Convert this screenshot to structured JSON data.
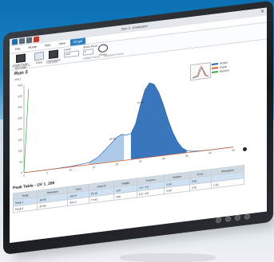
{
  "window": {
    "title": "Run 3 - Evaluation"
  },
  "menu": {
    "items": [
      "File",
      "Home",
      "Run",
      "View",
      "Graph"
    ],
    "active_index": 4
  },
  "ribbon": {
    "buttons": [
      {
        "label": "Single Peak / All Peaks",
        "icon": "peak-select-icon"
      },
      {
        "label": "Copy",
        "icon": "copy-icon"
      },
      {
        "label": "Calculation",
        "icon": "calculator-icon"
      },
      {
        "label": "Reset",
        "icon": "reset-icon"
      }
    ],
    "level_label": "Level",
    "level_value": "50.0",
    "show_point_label": "Show Point",
    "show_point_value": "5",
    "group_labels": [
      "Graph Options",
      "Calculate",
      "Global Points",
      "Standard Points"
    ]
  },
  "chart_header": {
    "title": "Run 3",
    "y_unit": "mAU"
  },
  "chart_data": {
    "type": "area",
    "title": "Run 3",
    "ylabel": "mAU",
    "xlim": [
      0,
      45
    ],
    "ylim": [
      0,
      400
    ],
    "y_ticks": [
      400,
      350,
      300,
      250,
      200,
      150,
      100,
      50,
      0
    ],
    "x_ticks": [
      0,
      5,
      10,
      15,
      20,
      25,
      30,
      35,
      40,
      45
    ],
    "series": [
      {
        "name": "Weight",
        "color": "#2a5fa8",
        "x": [
          0,
          5,
          10,
          14,
          16,
          18,
          20,
          21,
          22,
          23,
          24,
          25,
          26,
          27,
          28,
          29,
          30,
          31,
          32,
          33,
          34,
          35,
          36,
          38,
          40,
          42,
          45
        ],
        "values": [
          0,
          0,
          2,
          10,
          30,
          70,
          110,
          120,
          115,
          118,
          160,
          240,
          310,
          340,
          330,
          290,
          230,
          160,
          100,
          55,
          25,
          10,
          4,
          1,
          0,
          0,
          0
        ]
      },
      {
        "name": "Signal",
        "color": "#e0632b",
        "x": [
          0,
          45
        ],
        "values": [
          0,
          0
        ]
      },
      {
        "name": "Baseline",
        "color": "#3aa844",
        "x": [
          0,
          1
        ],
        "values": [
          0,
          380
        ]
      }
    ],
    "peaks": [
      {
        "label": "Peak 1",
        "start": 14,
        "end": 21.5,
        "fill": "#a9c7e8"
      },
      {
        "label": "Peak 2",
        "start": 23,
        "end": 35,
        "fill": "#2e6fb8"
      }
    ],
    "annotations": [
      "19.00",
      "25.00"
    ],
    "grid": false,
    "legend": "top-right"
  },
  "peak_table": {
    "title": "Peak Table - UV 1_280",
    "columns": [
      "Peak",
      "Retention",
      "Area",
      "Area %",
      "Height",
      "Fraction",
      "Volume",
      "Conc.",
      "Resolution"
    ],
    "rows": [
      {
        "cells": [
          "Peak 1",
          "19.00",
          "262.9",
          "22.16",
          "120",
          "4.0 - 5.5",
          "1.50",
          "0.82",
          ""
        ],
        "selected": true
      },
      {
        "cells": [
          "Peak 2",
          "25.00",
          "924.3",
          "77.84",
          "340",
          "6.0 - 9.0",
          "3.00",
          "2.91",
          "1.62"
        ],
        "selected": false
      }
    ]
  },
  "colors": {
    "accent": "#2e7fc2",
    "peak_light": "#a9c7e8",
    "peak_dark": "#2e6fb8"
  }
}
